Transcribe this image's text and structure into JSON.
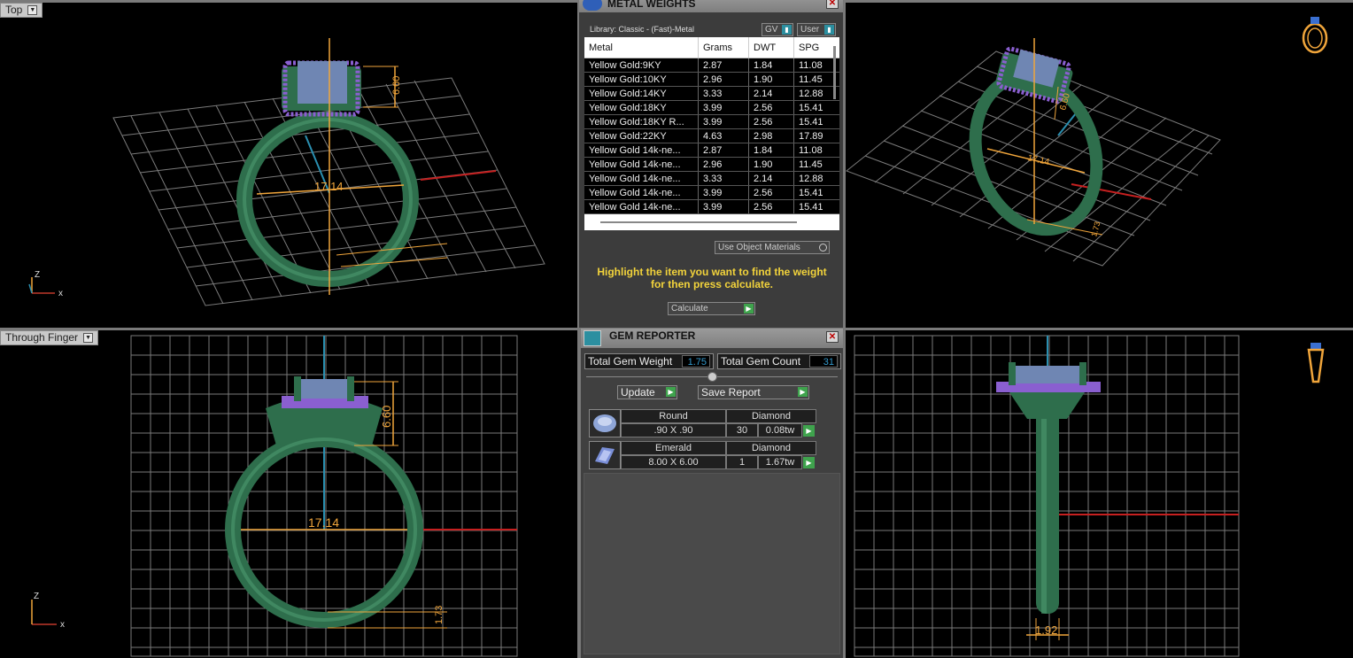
{
  "viewports": {
    "top_left": {
      "label": "Top",
      "dim_width": "17.14",
      "dim_height": "6.60",
      "axis_z": "Z",
      "axis_x": "x"
    },
    "top_right": {
      "dim_width": "17.14",
      "dim_height": "6.60",
      "dim_small": "1.73"
    },
    "bottom_left": {
      "label": "Through Finger",
      "dim_width": "17.14",
      "dim_height": "6.60",
      "dim_small": "1.73",
      "axis_z": "Z",
      "axis_x": "x"
    },
    "bottom_right": {
      "dim_width": "1.92"
    }
  },
  "metal_weights": {
    "title": "METAL WEIGHTS",
    "library": "Library: Classic - (Fast)-Metal",
    "toggle_gv": "GV",
    "toggle_user": "User",
    "columns": [
      "Metal",
      "Grams",
      "DWT",
      "SPG"
    ],
    "rows": [
      [
        "Yellow Gold:9KY",
        "2.87",
        "1.84",
        "11.08"
      ],
      [
        "Yellow Gold:10KY",
        "2.96",
        "1.90",
        "11.45"
      ],
      [
        "Yellow Gold:14KY",
        "3.33",
        "2.14",
        "12.88"
      ],
      [
        "Yellow Gold:18KY",
        "3.99",
        "2.56",
        "15.41"
      ],
      [
        "Yellow Gold:18KY R...",
        "3.99",
        "2.56",
        "15.41"
      ],
      [
        "Yellow Gold:22KY",
        "4.63",
        "2.98",
        "17.89"
      ],
      [
        "Yellow Gold 14k-ne...",
        "2.87",
        "1.84",
        "11.08"
      ],
      [
        "Yellow Gold 14k-ne...",
        "2.96",
        "1.90",
        "11.45"
      ],
      [
        "Yellow Gold 14k-ne...",
        "3.33",
        "2.14",
        "12.88"
      ],
      [
        "Yellow Gold 14k-ne...",
        "3.99",
        "2.56",
        "15.41"
      ],
      [
        "Yellow Gold 14k-ne...",
        "3.99",
        "2.56",
        "15.41"
      ]
    ],
    "use_object_materials": "Use Object Materials",
    "hint_line1": "Highlight the item you want to find the weight",
    "hint_line2": "for then press calculate.",
    "calculate_label": "Calculate"
  },
  "gem_reporter": {
    "title": "GEM REPORTER",
    "total_weight_label": "Total Gem Weight",
    "total_weight_value": "1.75",
    "total_count_label": "Total Gem Count",
    "total_count_value": "31",
    "update_label": "Update",
    "save_report_label": "Save Report",
    "gems": [
      {
        "shape": "Round",
        "material": "Diamond",
        "size": ".90 X .90",
        "count": "30",
        "weight": "0.08tw",
        "icon": "round-gem-icon"
      },
      {
        "shape": "Emerald",
        "material": "Diamond",
        "size": "8.00 X 6.00",
        "count": "1",
        "weight": "1.67tw",
        "icon": "emerald-gem-icon"
      }
    ]
  },
  "colors": {
    "ring_green": "#2e6e4c",
    "dim_orange": "#f0a53b",
    "gem_blue": "#6f86b3",
    "accent_purple": "#8a5fd0",
    "hint_yellow": "#f2d33b"
  }
}
